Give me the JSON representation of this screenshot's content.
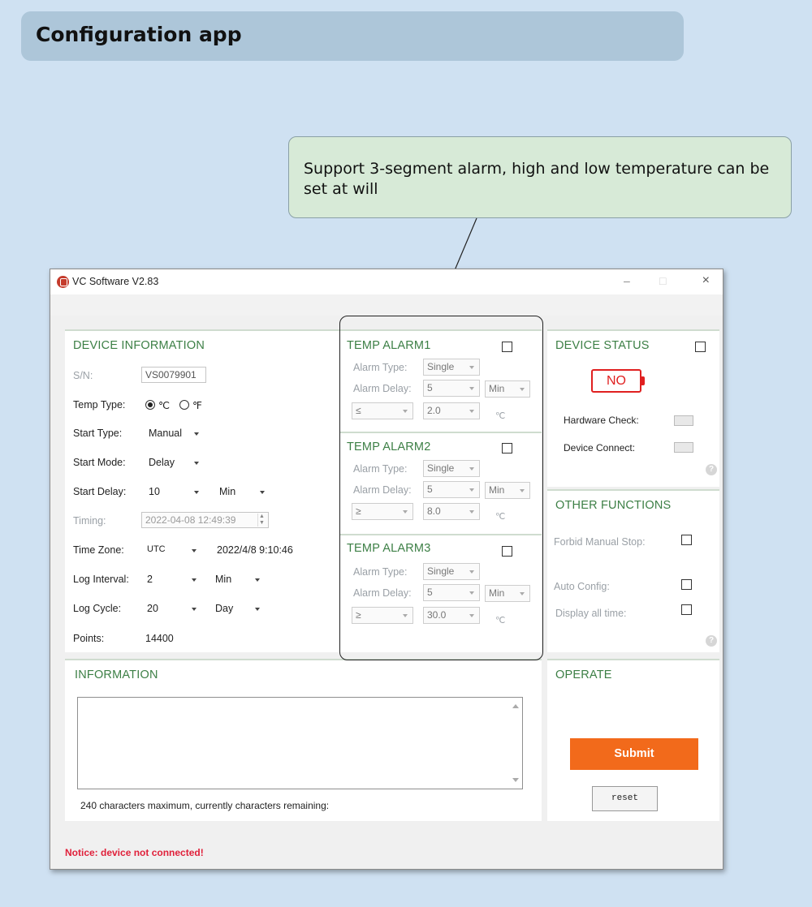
{
  "banner": {
    "title": "Configuration app"
  },
  "callout": {
    "text": "Support 3-segment alarm, high and low temperature can be set at will"
  },
  "window": {
    "title": "VC Software V2.83",
    "controls": {
      "minimize": "–",
      "maximize": "□",
      "close": "×"
    }
  },
  "device_info": {
    "heading": "DEVICE INFORMATION",
    "sn_label": "S/N:",
    "sn_value": "VS0079901",
    "temp_type_label": "Temp Type:",
    "temp_c": "℃",
    "temp_f": "℉",
    "temp_selected": "℃",
    "start_type_label": "Start Type:",
    "start_type_value": "Manual",
    "start_mode_label": "Start Mode:",
    "start_mode_value": "Delay",
    "start_delay_label": "Start Delay:",
    "start_delay_value": "10",
    "start_delay_unit": "Min",
    "timing_label": "Timing:",
    "timing_value": "2022-04-08 12:49:39",
    "time_zone_label": "Time Zone:",
    "time_zone_value": "UTC",
    "time_zone_clock": "2022/4/8 9:10:46",
    "log_interval_label": "Log Interval:",
    "log_interval_value": "2",
    "log_interval_unit": "Min",
    "log_cycle_label": "Log Cycle:",
    "log_cycle_value": "20",
    "log_cycle_unit": "Day",
    "points_label": "Points:",
    "points_value": "14400"
  },
  "alarms": [
    {
      "heading": "TEMP ALARM1",
      "type_label": "Alarm Type:",
      "type_value": "Single",
      "delay_label": "Alarm Delay:",
      "delay_value": "5",
      "delay_unit": "Min",
      "operator": "≤",
      "threshold": "2.0",
      "unit": "℃"
    },
    {
      "heading": "TEMP ALARM2",
      "type_label": "Alarm Type:",
      "type_value": "Single",
      "delay_label": "Alarm Delay:",
      "delay_value": "5",
      "delay_unit": "Min",
      "operator": "≥",
      "threshold": "8.0",
      "unit": "℃"
    },
    {
      "heading": "TEMP ALARM3",
      "type_label": "Alarm Type:",
      "type_value": "Single",
      "delay_label": "Alarm Delay:",
      "delay_value": "5",
      "delay_unit": "Min",
      "operator": "≥",
      "threshold": "30.0",
      "unit": "℃"
    }
  ],
  "device_status": {
    "heading": "DEVICE STATUS",
    "battery_text": "NO",
    "hardware_check_label": "Hardware Check:",
    "device_connect_label": "Device Connect:",
    "help": "?",
    "accent_color": "#e02020"
  },
  "other_functions": {
    "heading": "OTHER FUNCTIONS",
    "forbid_manual_stop_label": "Forbid Manual Stop:",
    "auto_config_label": "Auto Config:",
    "display_all_time_label": "Display all time:",
    "help": "?"
  },
  "information": {
    "heading": "INFORMATION",
    "text_value": "",
    "footer": "240 characters maximum, currently characters remaining:"
  },
  "operate": {
    "heading": "OPERATE",
    "submit_label": "Submit",
    "reset_label": "reset",
    "submit_color": "#f26a1b"
  },
  "status_bar": {
    "notice": "Notice: device not connected!"
  }
}
